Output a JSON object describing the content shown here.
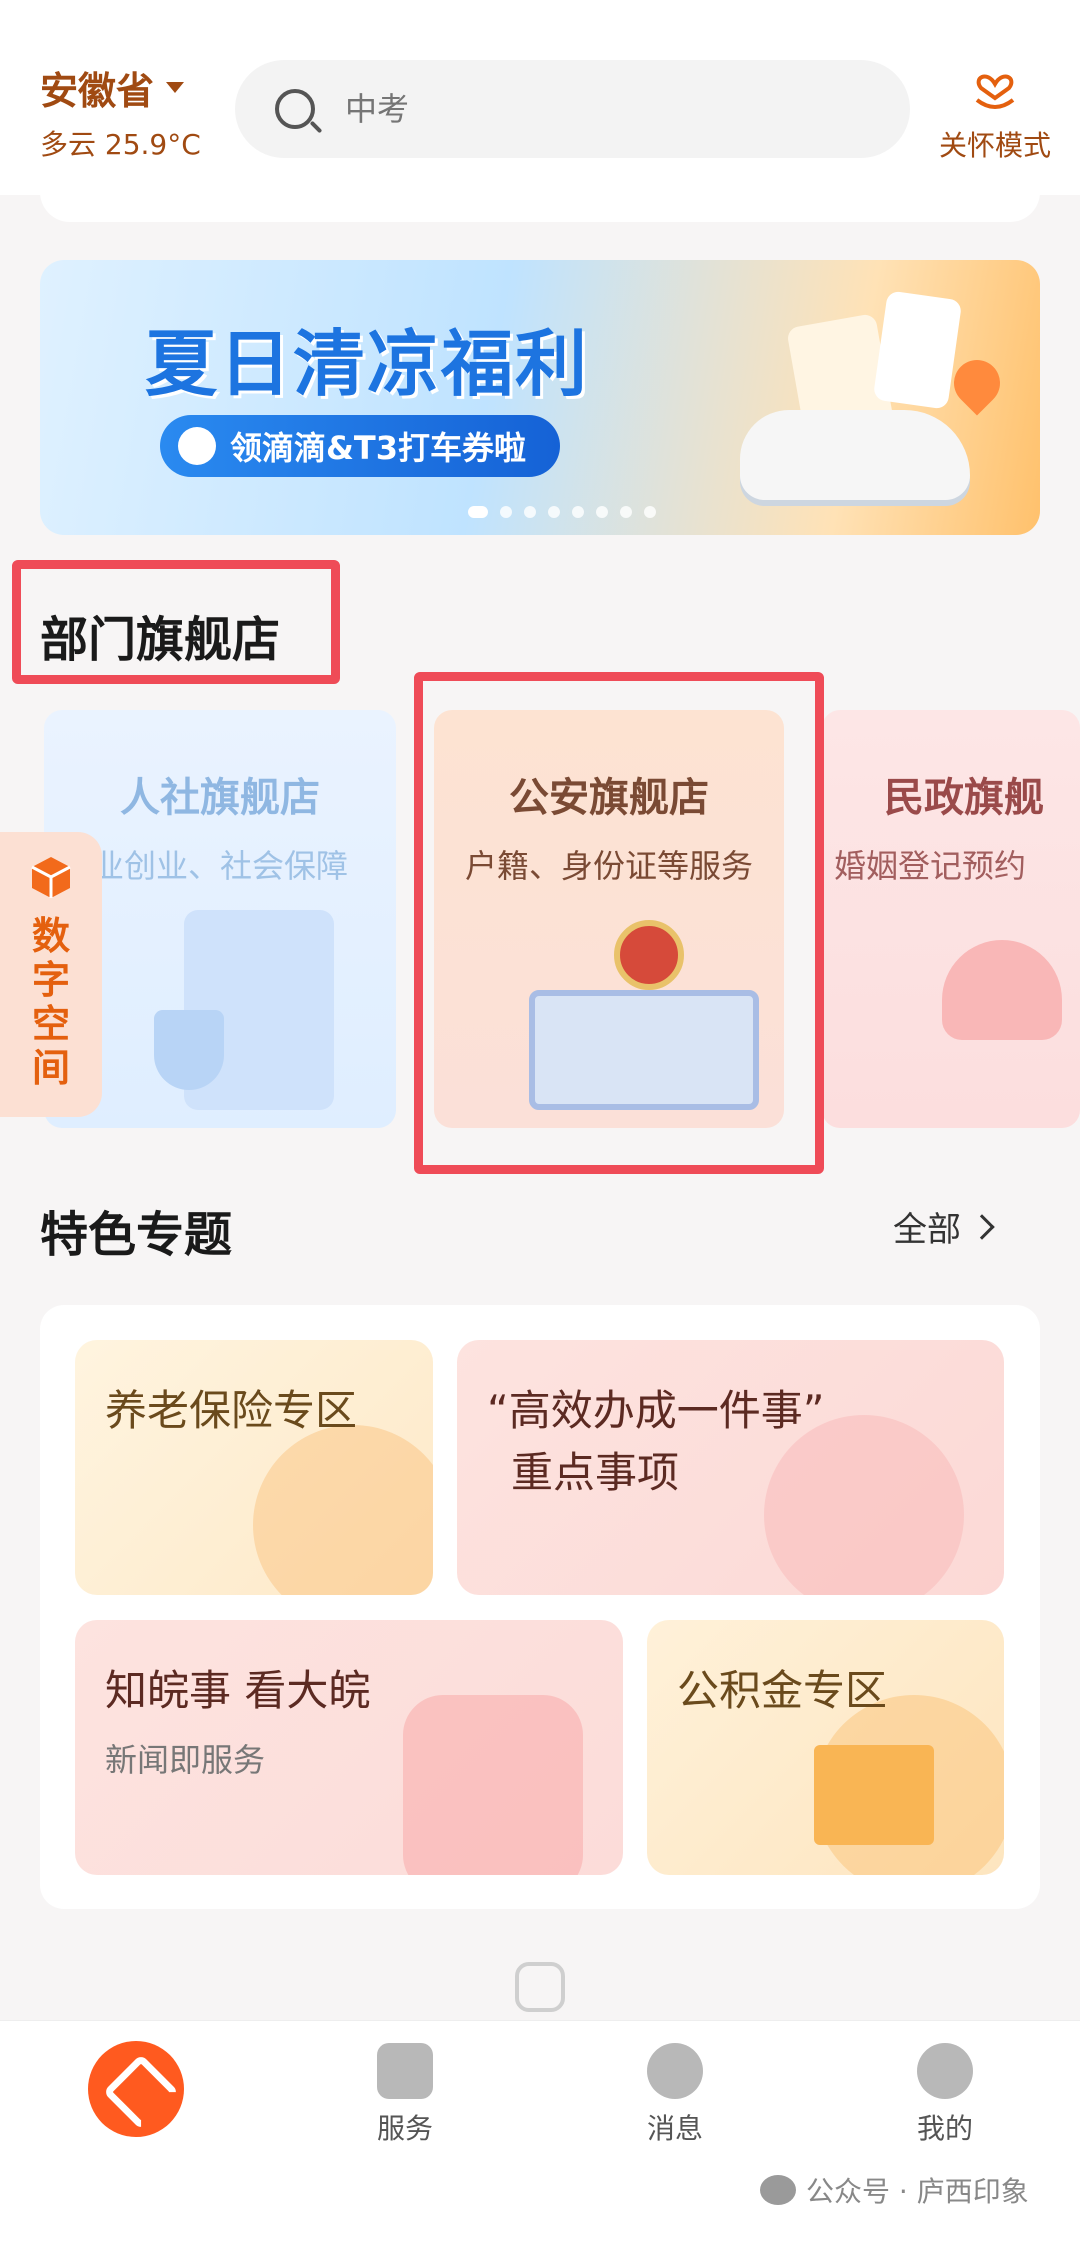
{
  "header": {
    "province": "安徽省",
    "weather": "多云 25.9°C",
    "search_placeholder": "中考",
    "care_mode": "关怀模式"
  },
  "banner": {
    "title": "夏日清凉福利",
    "subtitle": "领滴滴&T3打车券啦",
    "total_slides": 8,
    "active_slide": 1
  },
  "flagship": {
    "title": "部门旗舰店",
    "stores": [
      {
        "name": "人社旗舰店",
        "desc": "业创业、社会保障"
      },
      {
        "name": "公安旗舰店",
        "desc": "户籍、身份证等服务"
      },
      {
        "name": "民政旗舰",
        "desc": "婚姻登记预约"
      }
    ]
  },
  "digital_space": {
    "label": "数字空间"
  },
  "featured": {
    "title": "特色专题",
    "more": "全部",
    "topics": [
      {
        "title": "养老保险专区"
      },
      {
        "title": "“高效办成一件事”",
        "title2": "重点事项"
      },
      {
        "title": "知皖事 看大皖",
        "sub": "新闻即服务"
      },
      {
        "title": "公积金专区"
      }
    ]
  },
  "nav": {
    "items": [
      {
        "label": "",
        "icon": "home-logo-icon"
      },
      {
        "label": "服务",
        "icon": "services-icon"
      },
      {
        "label": "消息",
        "icon": "message-icon"
      },
      {
        "label": "我的",
        "icon": "profile-icon"
      }
    ]
  },
  "watermark": "公众号 · 庐西印象",
  "colors": {
    "accent": "#ff5a1f",
    "highlight": "#ef4b57",
    "brown": "#a04a12"
  }
}
